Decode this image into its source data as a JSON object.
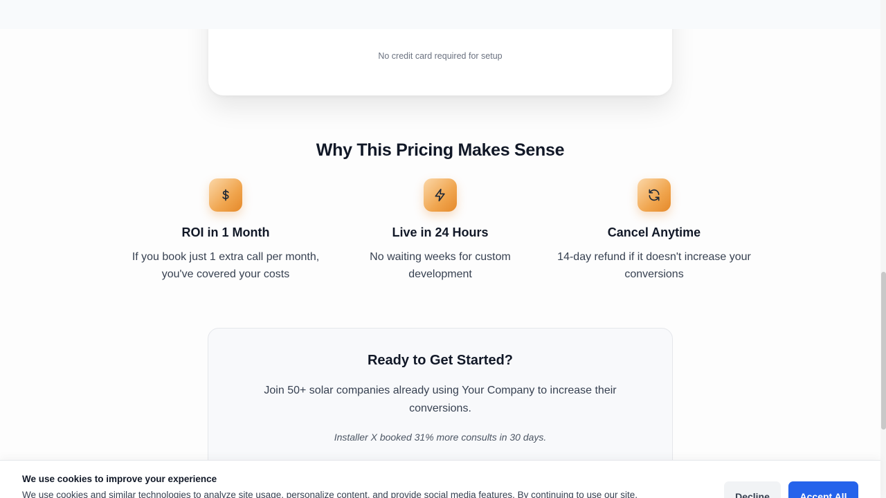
{
  "pricing_card": {
    "note": "No credit card required for setup"
  },
  "why_section": {
    "title": "Why This Pricing Makes Sense",
    "features": [
      {
        "icon": "dollar-icon",
        "title": "ROI in 1 Month",
        "text": "If you book just 1 extra call per month, you've covered your costs"
      },
      {
        "icon": "lightning-icon",
        "title": "Live in 24 Hours",
        "text": "No waiting weeks for custom development"
      },
      {
        "icon": "refresh-icon",
        "title": "Cancel Anytime",
        "text": "14-day refund if it doesn't increase your conversions"
      }
    ]
  },
  "cta": {
    "title": "Ready to Get Started?",
    "subtitle": "Join 50+ solar companies already using Your Company to increase their conversions.",
    "quote": "Installer X booked 31% more consults in 30 days."
  },
  "cookie_banner": {
    "title": "We use cookies to improve your experience",
    "text": "We use cookies and similar technologies to analyze site usage, personalize content, and provide social media features. By continuing to use our site,",
    "decline_label": "Decline",
    "accept_label": "Accept All"
  },
  "colors": {
    "accent": "#2563eb",
    "icon_gradient_start": "#fbd7a8",
    "icon_gradient_end": "#e5892a"
  }
}
